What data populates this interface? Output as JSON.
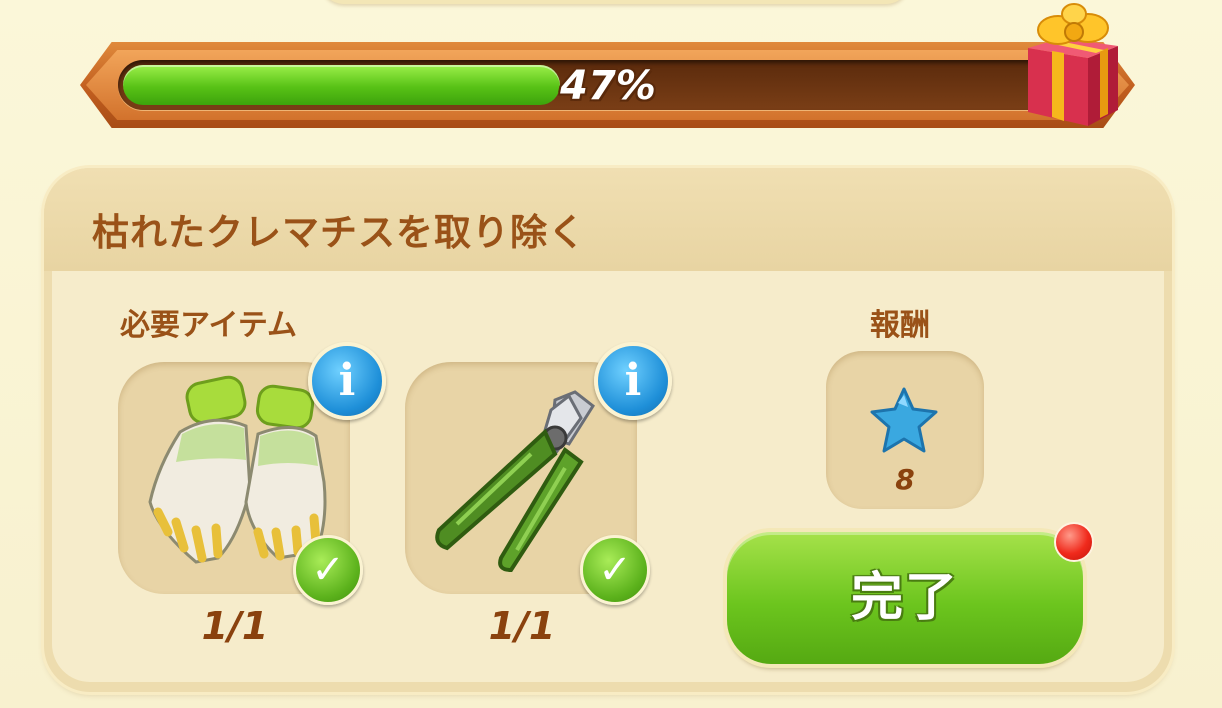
{
  "progress": {
    "percent": 47,
    "label": "47%"
  },
  "task": {
    "title": "枯れたクレマチスを取り除く",
    "required_label": "必要アイテム",
    "reward_label": "報酬",
    "items": [
      {
        "name": "gardening-gloves",
        "count": "1/1",
        "complete": true
      },
      {
        "name": "pruning-shears",
        "count": "1/1",
        "complete": true
      }
    ],
    "reward": {
      "icon": "blue-star-icon",
      "value": "8"
    },
    "complete_button": "完了"
  },
  "icons": {
    "info": "i",
    "check": "✓"
  },
  "colors": {
    "progress_fill": "#58c216",
    "accent_brown": "#9a5218",
    "button_green": "#6cc51e",
    "info_blue": "#1e8fd8",
    "star_blue": "#3aa8e0",
    "notify_red": "#f02a1c"
  }
}
